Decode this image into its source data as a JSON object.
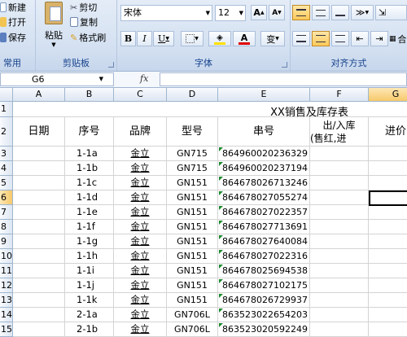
{
  "ribbon": {
    "clipboard": {
      "new": "新建",
      "open": "打开",
      "save": "保存",
      "common_label": "常用",
      "paste": "粘贴",
      "cut": "剪切",
      "copy": "复制",
      "format_painter": "格式刷",
      "group_label": "剪贴板"
    },
    "font": {
      "font_name": "宋体",
      "font_size": "12",
      "bold": "B",
      "italic": "I",
      "underline": "U",
      "font_color_glyph": "A",
      "grow": "A",
      "shrink": "A",
      "phonetic": "变",
      "group_label": "字体"
    },
    "alignment": {
      "group_label": "对齐方式",
      "merge": "合并"
    }
  },
  "formula_bar": {
    "name_box": "G6",
    "fx": "fx",
    "formula": ""
  },
  "columns": [
    "A",
    "B",
    "C",
    "D",
    "E",
    "F",
    "G"
  ],
  "rows": [
    "1",
    "2",
    "3",
    "4",
    "5",
    "6",
    "7",
    "8",
    "9",
    "10",
    "11",
    "12",
    "13",
    "14",
    "15"
  ],
  "sheet": {
    "title": "XX销售及库存表",
    "headers": {
      "date": "日期",
      "seq": "序号",
      "brand": "品牌",
      "model": "型号",
      "serial": "串号",
      "io_line1": "出/入库",
      "io_line2": "(售红,进",
      "price": "进价"
    },
    "data": [
      {
        "seq": "1-1a",
        "brand": "金立",
        "model": "GN715",
        "serial": "864960020236329"
      },
      {
        "seq": "1-1b",
        "brand": "金立",
        "model": "GN715",
        "serial": "864960020237194"
      },
      {
        "seq": "1-1c",
        "brand": "金立",
        "model": "GN151",
        "serial": "864678026713246"
      },
      {
        "seq": "1-1d",
        "brand": "金立",
        "model": "GN151",
        "serial": "864678027055274"
      },
      {
        "seq": "1-1e",
        "brand": "金立",
        "model": "GN151",
        "serial": "864678027022357"
      },
      {
        "seq": "1-1f",
        "brand": "金立",
        "model": "GN151",
        "serial": "864678027713691"
      },
      {
        "seq": "1-1g",
        "brand": "金立",
        "model": "GN151",
        "serial": "864678027640084"
      },
      {
        "seq": "1-1h",
        "brand": "金立",
        "model": "GN151",
        "serial": "864678027022316"
      },
      {
        "seq": "1-1i",
        "brand": "金立",
        "model": "GN151",
        "serial": "864678025694538"
      },
      {
        "seq": "1-1j",
        "brand": "金立",
        "model": "GN151",
        "serial": "864678027102175"
      },
      {
        "seq": "1-1k",
        "brand": "金立",
        "model": "GN151",
        "serial": "864678026729937"
      },
      {
        "seq": "2-1a",
        "brand": "金立",
        "model": "GN706L",
        "serial": "863523022654203"
      },
      {
        "seq": "2-1b",
        "brand": "金立",
        "model": "GN706L",
        "serial": "863523020592249"
      }
    ]
  },
  "colors": {
    "ribbon_label": "#15428b",
    "serial_marker": "#1d8a2e",
    "font_color_bar": "#e00000",
    "highlight_bar": "#ffe000"
  }
}
